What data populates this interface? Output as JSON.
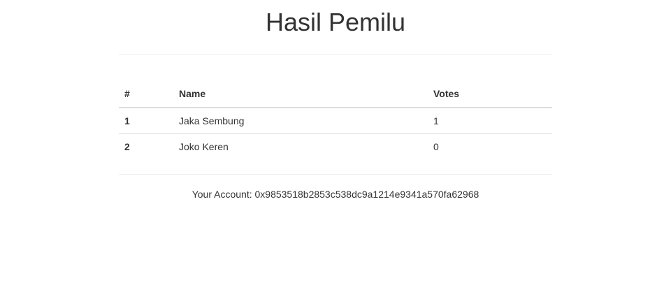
{
  "page": {
    "title": "Hasil Pemilu"
  },
  "table": {
    "headers": {
      "number": "#",
      "name": "Name",
      "votes": "Votes"
    },
    "rows": [
      {
        "number": "1",
        "name": "Jaka Sembung",
        "votes": "1"
      },
      {
        "number": "2",
        "name": "Joko Keren",
        "votes": "0"
      }
    ]
  },
  "account": {
    "label": "Your Account:",
    "address": "0x9853518b2853c538dc9a1214e9341a570fa62968"
  }
}
